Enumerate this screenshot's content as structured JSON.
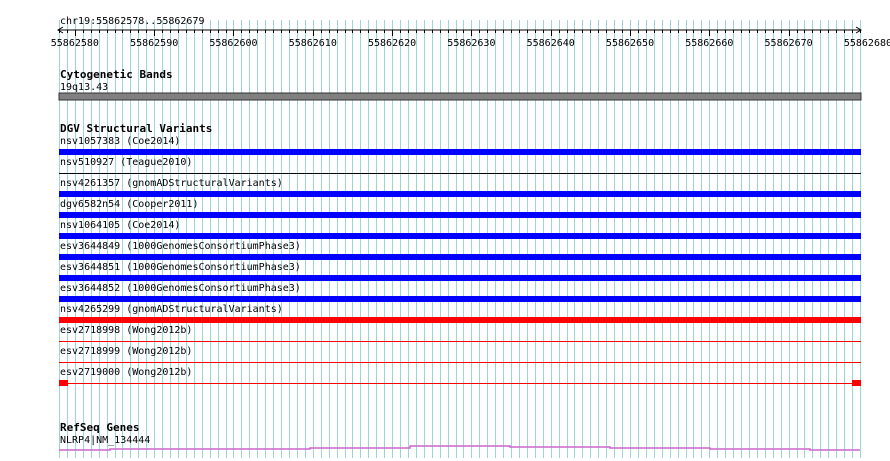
{
  "view": {
    "region": "chr19:55862578..55862679",
    "start": 55862578,
    "end": 55862679
  },
  "ruler": {
    "labels": [
      "55862580",
      "55862590",
      "55862600",
      "55862610",
      "55862620",
      "55862630",
      "55862640",
      "55862650",
      "55862660",
      "55862670",
      "55862680"
    ]
  },
  "tracks": {
    "cytoband": {
      "title": "Cytogenetic Bands",
      "band_label": "19q13.43",
      "color": "#808080"
    },
    "dgv": {
      "title": "DGV Structural Variants",
      "features": [
        {
          "label": "nsv1057383 (Coe2014)",
          "style": "thick",
          "color": "#0000ff"
        },
        {
          "label": "nsv510927 (Teague2010)",
          "style": "thin",
          "color": "#000000"
        },
        {
          "label": "nsv4261357 (gnomADStructuralVariants)",
          "style": "thick",
          "color": "#0000ff"
        },
        {
          "label": "dgv6582n54 (Cooper2011)",
          "style": "thick",
          "color": "#0000ff"
        },
        {
          "label": "nsv1064105 (Coe2014)",
          "style": "thick",
          "color": "#0000ff"
        },
        {
          "label": "esv3644849 (1000GenomesConsortiumPhase3)",
          "style": "thick",
          "color": "#0000ff"
        },
        {
          "label": "esv3644851 (1000GenomesConsortiumPhase3)",
          "style": "thick",
          "color": "#0000ff"
        },
        {
          "label": "esv3644852 (1000GenomesConsortiumPhase3)",
          "style": "thick",
          "color": "#0000ff"
        },
        {
          "label": "nsv4265299 (gnomADStructuralVariants)",
          "style": "thick",
          "color": "#ff0000"
        },
        {
          "label": "esv2718998 (Wong2012b)",
          "style": "thin",
          "color": "#ff0000"
        },
        {
          "label": "esv2718999 (Wong2012b)",
          "style": "thin",
          "color": "#ff0000"
        },
        {
          "label": "esv2719000 (Wong2012b)",
          "style": "thin-ends",
          "color": "#ff0000"
        }
      ]
    },
    "refseq": {
      "title": "RefSeq Genes",
      "gene_label": "NLRP4|NM_134444",
      "color": "#cc66cc"
    }
  },
  "colors": {
    "grid": "#9fd4dc",
    "ruler": "#000000"
  }
}
